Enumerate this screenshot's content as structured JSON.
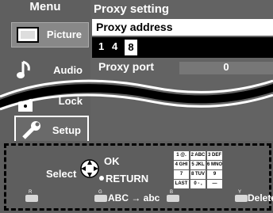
{
  "sidebar": {
    "title": "Menu",
    "items": [
      {
        "label": "Picture",
        "icon": "picture-icon"
      },
      {
        "label": "Audio",
        "icon": "music-note-icon"
      },
      {
        "label": "Lock",
        "icon": "lock-icon"
      },
      {
        "label": "Setup",
        "icon": "wrench-icon",
        "active": true
      }
    ]
  },
  "panel": {
    "title": "Proxy setting",
    "address_label": "Proxy address",
    "address_digits": [
      "1",
      "4",
      "8"
    ],
    "port_label": "Proxy port",
    "port_value": "0"
  },
  "guide": {
    "select": "Select",
    "ok": "OK",
    "return": "RETURN",
    "numpad": [
      "1 @.",
      "2 ABC",
      "3 DEF",
      "4 GHI",
      "5 JKL",
      "6 MNO",
      "7 PQRS",
      "8 TUV",
      "9 WXYZ",
      "LAST",
      "0 - ,",
      "—"
    ],
    "colors": [
      {
        "letter": "R",
        "label": ""
      },
      {
        "letter": "G",
        "label": "ABC → abc"
      },
      {
        "letter": "B",
        "label": ""
      },
      {
        "letter": "Y",
        "label": "Delete"
      }
    ]
  },
  "colors": {
    "background": "#000000",
    "panel": "#636363",
    "sidebar": "#5f5f5f",
    "text": "#ffffff"
  }
}
